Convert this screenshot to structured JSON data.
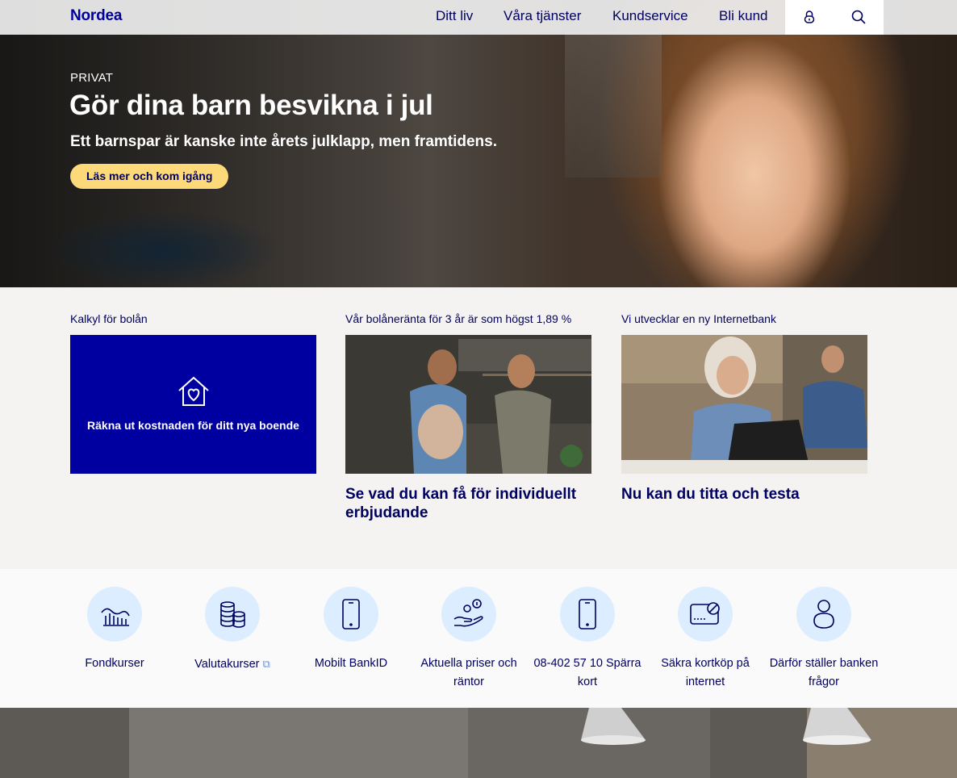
{
  "header": {
    "logo": "Nordea",
    "nav": [
      "Ditt liv",
      "Våra tjänster",
      "Kundservice",
      "Bli kund"
    ],
    "icons": [
      "lock-icon",
      "search-icon"
    ]
  },
  "hero": {
    "label": "PRIVAT",
    "title": "Gör dina barn besvikna i jul",
    "subtitle": "Ett barnspar är kanske inte årets julklapp, men framtidens.",
    "cta": "Läs mer och kom igång"
  },
  "cards": [
    {
      "label": "Kalkyl för bolån",
      "box_text": "Räkna ut kostnaden för ditt nya boende",
      "icon": "house-heart-icon"
    },
    {
      "label": "Vår bolåneränta för 3 år är som högst 1,89 %",
      "title": "Se vad du kan få för individuellt erbjudande"
    },
    {
      "label": "Vi utvecklar en ny Internetbank",
      "title": "Nu kan du titta och testa"
    }
  ],
  "quick_links": [
    {
      "label": "Fondkurser",
      "icon": "fund-chart-icon"
    },
    {
      "label": "Valutakurser",
      "icon": "coins-icon",
      "external": true
    },
    {
      "label": "Mobilt BankID",
      "icon": "mobile-icon"
    },
    {
      "label": "Aktuella priser och räntor",
      "icon": "hand-coins-icon"
    },
    {
      "label": "08-402 57 10 Spärra kort",
      "icon": "mobile-icon"
    },
    {
      "label": "Säkra kortköp på internet",
      "icon": "secure-card-icon"
    },
    {
      "label": "Därför ställer banken frågor",
      "icon": "person-icon"
    }
  ],
  "colors": {
    "brand": "#0000a0",
    "navy": "#00005e",
    "cta": "#fdd97a",
    "icon_bg": "#dcedff"
  }
}
